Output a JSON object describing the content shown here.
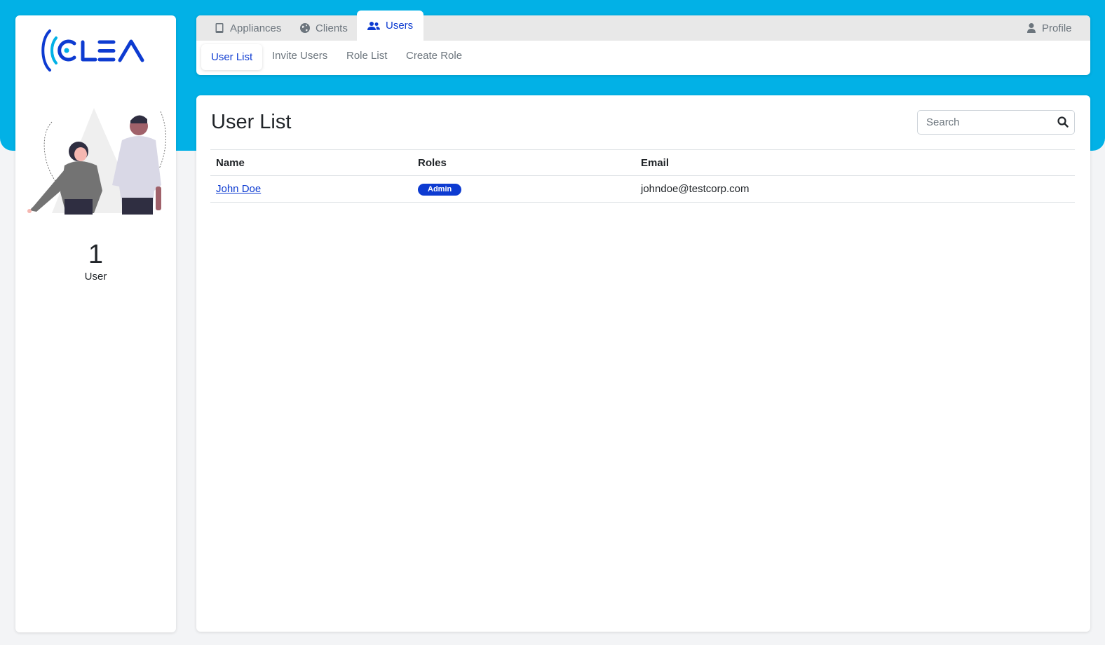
{
  "colors": {
    "header_bg": "#02b1e6",
    "accent": "#0d3bd1",
    "page_bg": "#f3f4f6"
  },
  "brand": {
    "logo_text": "CLEA"
  },
  "sidebar": {
    "count": "1",
    "count_label": "User"
  },
  "top_tabs": [
    {
      "label": "Appliances",
      "icon": "tablet-icon"
    },
    {
      "label": "Clients",
      "icon": "globe-icon"
    },
    {
      "label": "Users",
      "icon": "users-icon",
      "active": true
    }
  ],
  "profile": {
    "label": "Profile",
    "icon": "user-icon"
  },
  "sub_nav": [
    {
      "label": "User List",
      "active": true
    },
    {
      "label": "Invite Users"
    },
    {
      "label": "Role List"
    },
    {
      "label": "Create Role"
    }
  ],
  "main": {
    "title": "User List",
    "search": {
      "placeholder": "Search",
      "value": ""
    },
    "table": {
      "columns": [
        "Name",
        "Roles",
        "Email"
      ],
      "rows": [
        {
          "name": "John Doe",
          "role": "Admin",
          "email": "johndoe@testcorp.com"
        }
      ]
    }
  }
}
